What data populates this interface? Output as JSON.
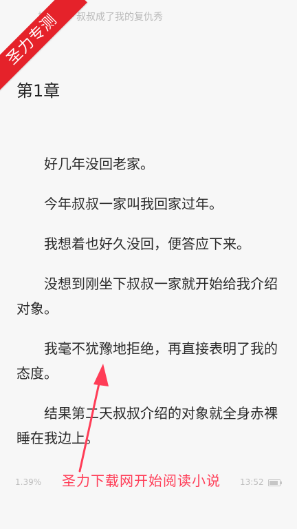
{
  "header": {
    "book_title": "拒婚后，叔叔成了我的复仇秀"
  },
  "ribbon": {
    "label": "圣力专测"
  },
  "chapter": {
    "title": "第1章"
  },
  "content": {
    "paragraphs": [
      "好几年没回老家。",
      "今年叔叔一家叫我回家过年。",
      "我想着也好久没回，便答应下来。",
      "没想到刚坐下叔叔一家就开始给我介绍对象。",
      "我毫不犹豫地拒绝，再直接表明了我的态度。",
      "结果第二天叔叔介绍的对象就全身赤裸睡在我边上。"
    ]
  },
  "footer": {
    "progress": "1.39%",
    "time": "13:52"
  },
  "annotation": {
    "text": "圣力下载网开始阅读小说"
  },
  "colors": {
    "background": "#f7f7f7",
    "ribbon": "#e5222a",
    "annotation": "#ff3d57"
  }
}
